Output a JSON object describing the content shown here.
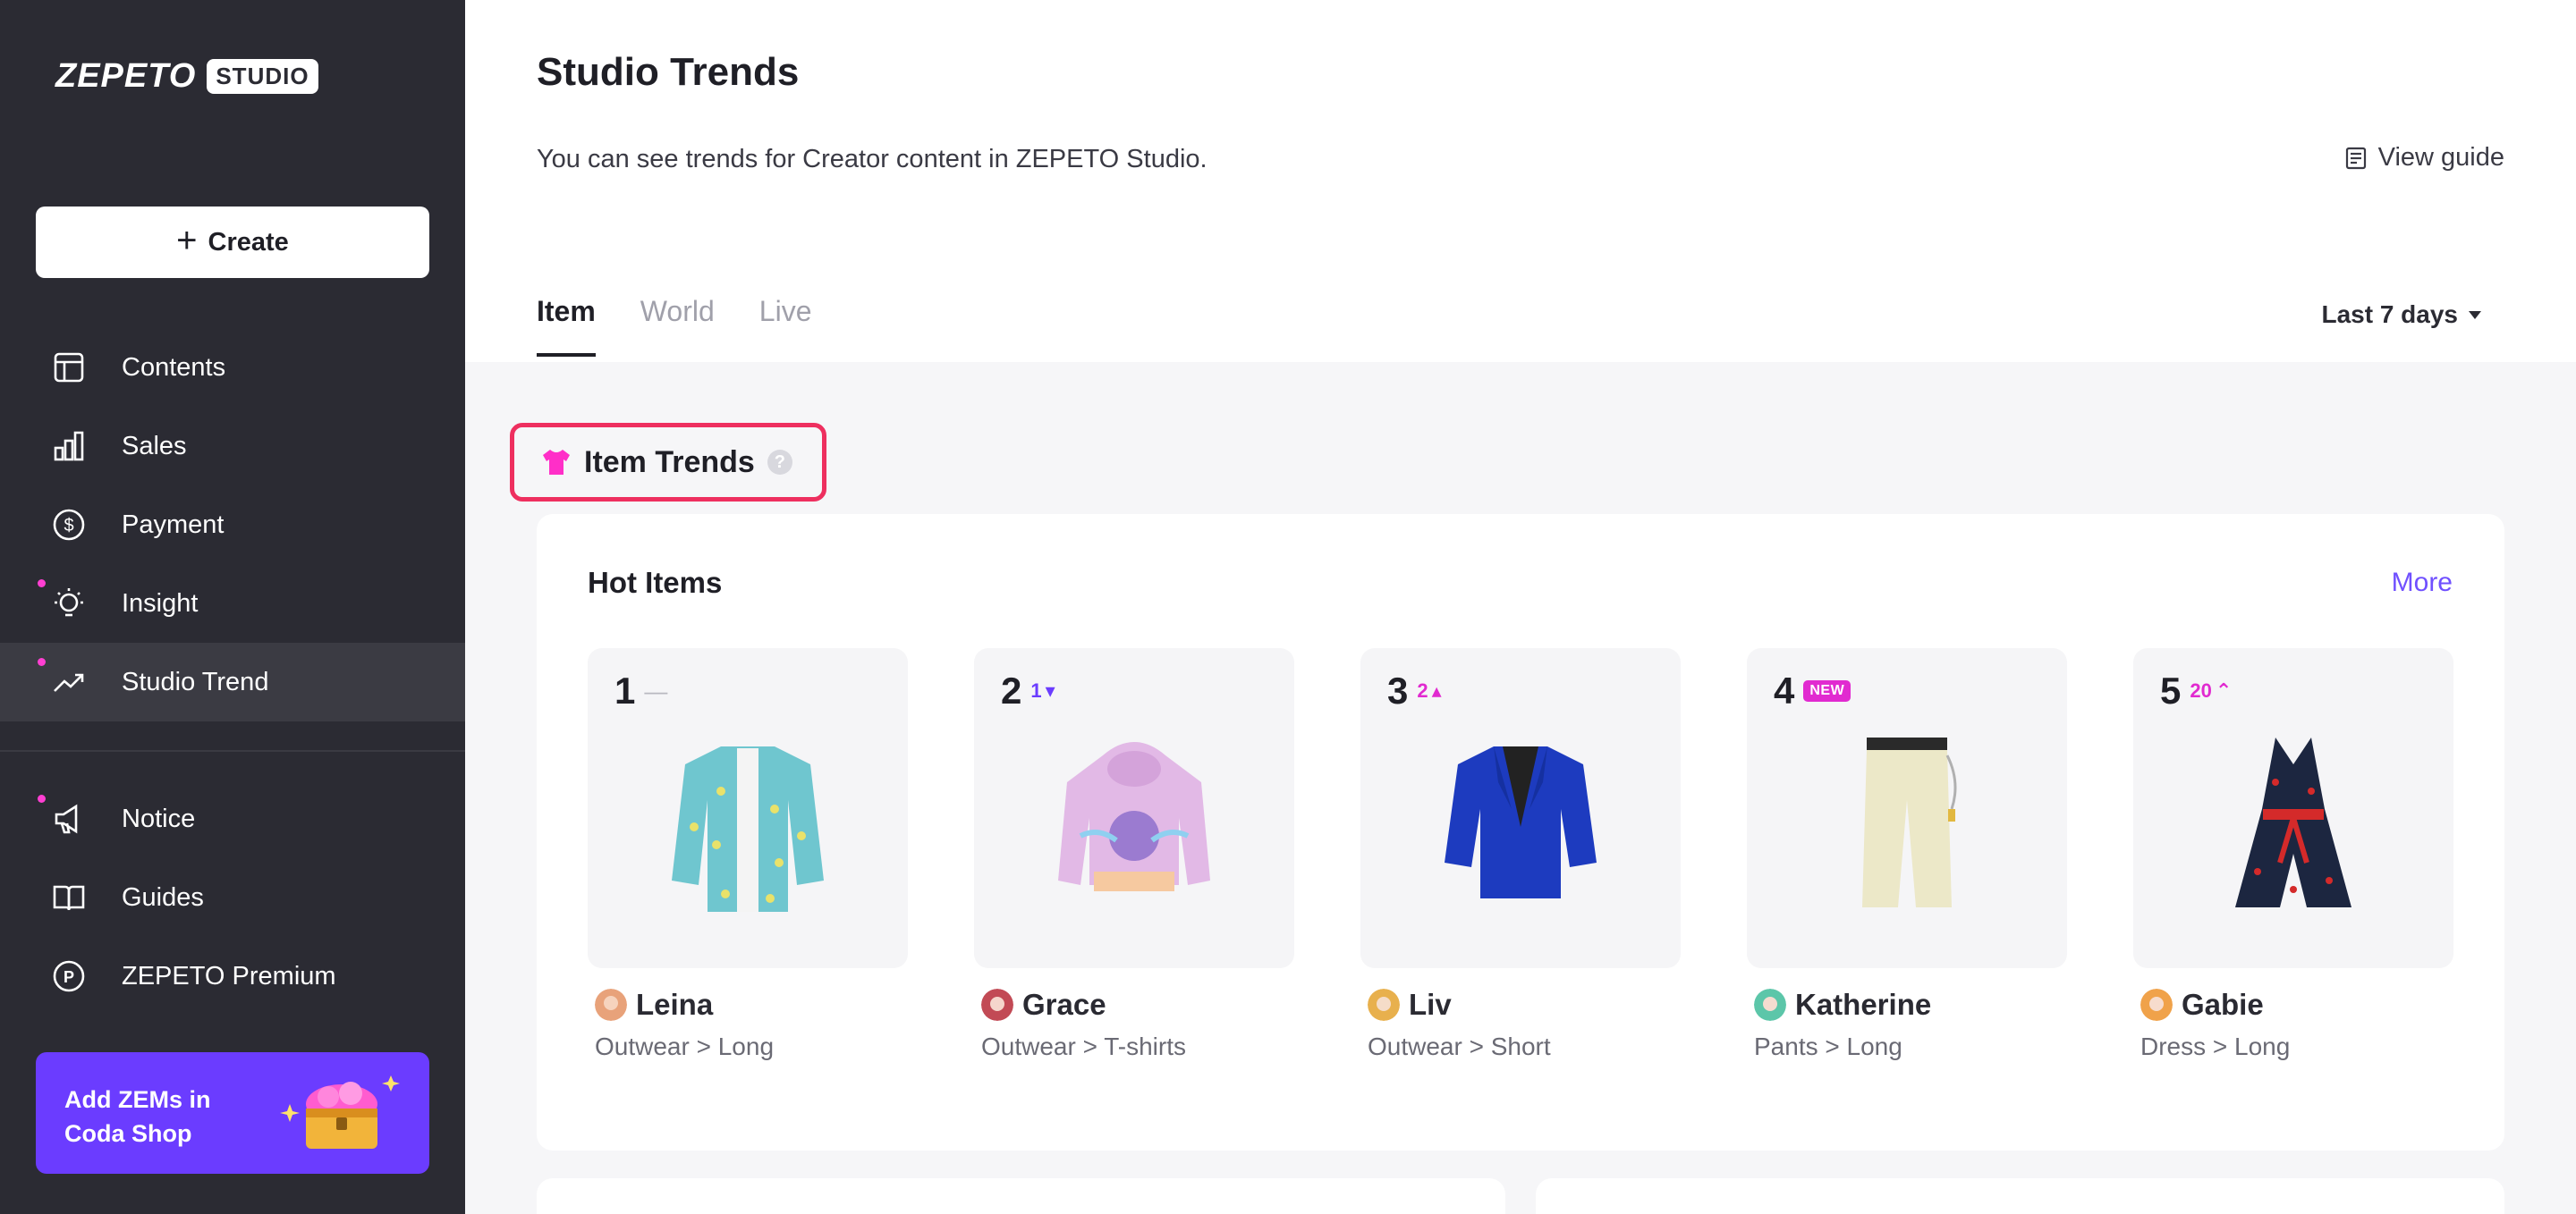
{
  "app": {
    "logo_word": "ZEPETO",
    "logo_badge": "STUDIO"
  },
  "sidebar": {
    "create_label": "Create",
    "items": [
      {
        "label": "Contents",
        "icon": "layout-icon"
      },
      {
        "label": "Sales",
        "icon": "bar-chart-icon"
      },
      {
        "label": "Payment",
        "icon": "dollar-icon"
      },
      {
        "label": "Insight",
        "icon": "lightbulb-icon",
        "dot": true
      },
      {
        "label": "Studio Trend",
        "icon": "trend-icon",
        "dot": true,
        "active": true
      },
      {
        "label": "Notice",
        "icon": "megaphone-icon",
        "dot": true
      },
      {
        "label": "Guides",
        "icon": "book-icon"
      },
      {
        "label": "ZEPETO Premium",
        "icon": "premium-icon"
      }
    ],
    "promo_text": "Add ZEMs in\nCoda Shop"
  },
  "header": {
    "title": "Studio Trends",
    "description": "You can see trends for Creator content in ZEPETO Studio.",
    "view_guide": "View guide"
  },
  "tabs": [
    {
      "label": "Item",
      "active": true
    },
    {
      "label": "World"
    },
    {
      "label": "Live"
    }
  ],
  "period": {
    "selected": "Last 7 days"
  },
  "section": {
    "title": "Item Trends",
    "help": "?"
  },
  "hot_items": {
    "title": "Hot Items",
    "more": "More",
    "items": [
      {
        "rank": "1",
        "delta": "—",
        "delta_type": "same",
        "creator": "Leina",
        "category": "Outwear > Long",
        "color": "#6fc6cf",
        "avatar_color": "#e8a27a"
      },
      {
        "rank": "2",
        "delta": "1",
        "delta_type": "down",
        "creator": "Grace",
        "category": "Outwear > T-shirts",
        "color": "#e2b9e6",
        "avatar_color": "#c24a55"
      },
      {
        "rank": "3",
        "delta": "2",
        "delta_type": "up",
        "creator": "Liv",
        "category": "Outwear > Short",
        "color": "#1d3bbf",
        "avatar_color": "#e8b04d"
      },
      {
        "rank": "4",
        "delta": "NEW",
        "delta_type": "new",
        "creator": "Katherine",
        "category": "Pants > Long",
        "color": "#ece8c8",
        "avatar_color": "#5cc6a9"
      },
      {
        "rank": "5",
        "delta": "20",
        "delta_type": "up2",
        "creator": "Gabie",
        "category": "Dress > Long",
        "color": "#1c2640",
        "avatar_color": "#f0a24a"
      }
    ]
  }
}
